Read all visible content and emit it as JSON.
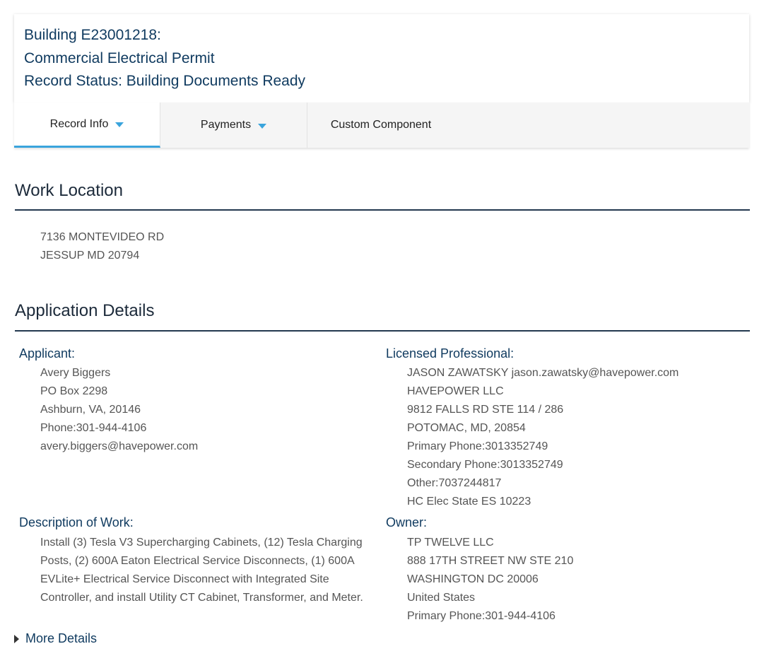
{
  "header": {
    "line1": "Building E23001218:",
    "line2": "Commercial Electrical Permit",
    "line3": "Record Status: Building Documents Ready"
  },
  "tabs": [
    {
      "label": "Record Info",
      "has_caret": true,
      "active": true
    },
    {
      "label": "Payments",
      "has_caret": true,
      "active": false
    },
    {
      "label": "Custom Component",
      "has_caret": false,
      "active": false
    }
  ],
  "work_location": {
    "title": "Work Location",
    "address": [
      "7136 MONTEVIDEO RD",
      "JESSUP MD 20794"
    ]
  },
  "application_details": {
    "title": "Application Details",
    "applicant": {
      "title": "Applicant:",
      "lines": [
        "Avery Biggers",
        "PO Box 2298",
        "Ashburn, VA, 20146",
        "Phone:301-944-4106",
        "avery.biggers@havepower.com"
      ]
    },
    "licensed_professional": {
      "title": "Licensed Professional:",
      "lines": [
        "JASON ZAWATSKY jason.zawatsky@havepower.com",
        "HAVEPOWER LLC",
        "9812 FALLS RD STE 114 / 286",
        "POTOMAC, MD, 20854",
        "Primary Phone:3013352749",
        "Secondary Phone:3013352749",
        "Other:7037244817",
        "HC Elec State ES 10223"
      ]
    },
    "description": {
      "title": "Description of Work:",
      "lines": [
        "Install (3) Tesla V3 Supercharging Cabinets, (12) Tesla Charging",
        "Posts, (2) 600A Eaton Electrical Service Disconnects, (1) 600A",
        "EVLite+ Electrical Service Disconnect with Integrated Site",
        "Controller, and install Utility CT Cabinet, Transformer, and Meter."
      ]
    },
    "owner": {
      "title": "Owner:",
      "lines": [
        "TP TWELVE LLC",
        "888 17TH STREET NW STE 210",
        "WASHINGTON DC 20006",
        "United States",
        "Primary Phone:301-944-4106"
      ]
    }
  },
  "more_details": {
    "label": "More Details"
  },
  "colors": {
    "heading_blue": "#0f3a5f",
    "tab_accent": "#3aa4dc",
    "rule": "#23384f"
  }
}
